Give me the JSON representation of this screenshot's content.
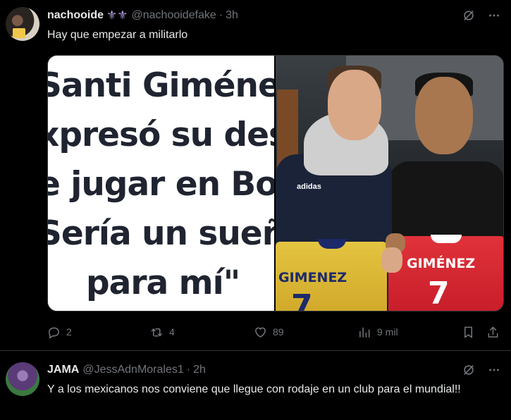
{
  "tweets": [
    {
      "display_name": "nachooide",
      "name_emoji": "⚜⚜",
      "handle": "@nachooidefake",
      "dot": "·",
      "time": "3h",
      "text": "Hay que empezar a militarlo",
      "media": {
        "headline_lines": [
          "Santi Giméne",
          "xpresó su des",
          "e jugar en Boc",
          "Sería un sueñ",
          "para mí\""
        ],
        "jersey_left_name": "GIMENEZ",
        "jersey_left_number": "7",
        "jersey_right_name": "GIMÉNEZ",
        "jersey_right_number": "7",
        "brand": "adidas"
      },
      "actions": {
        "reply_count": "2",
        "retweet_count": "4",
        "like_count": "89",
        "views_count": "9 mil"
      }
    },
    {
      "display_name": "JAMA",
      "handle": "@JessAdnMorales1",
      "dot": "·",
      "time": "2h",
      "text": "Y a los mexicanos nos conviene que llegue con rodaje en un club para el mundial!!"
    }
  ],
  "colors": {
    "background": "#000000",
    "text": "#e7e9ea",
    "muted": "#71767b",
    "border": "#2f3336"
  },
  "icons": [
    "grok-icon",
    "more-icon",
    "reply-icon",
    "retweet-icon",
    "like-icon",
    "views-icon",
    "bookmark-icon",
    "share-icon"
  ]
}
